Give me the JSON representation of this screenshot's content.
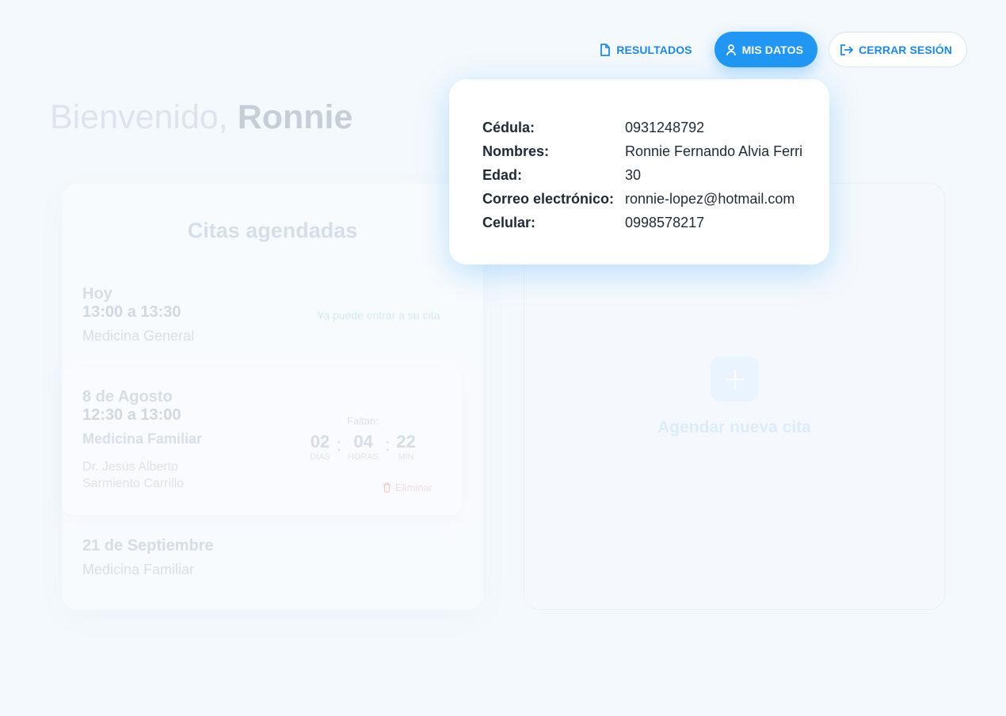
{
  "nav": {
    "results_label": "RESULTADOS",
    "mydata_label": "MIS DATOS",
    "logout_label": "CERRAR SESIÓN"
  },
  "welcome": {
    "greeting": "Bienvenido,",
    "name": "Ronnie"
  },
  "appointments": {
    "title": "Citas agendadas",
    "items": [
      {
        "day": "Hoy",
        "time": "13:00 a 13:30",
        "specialty": "Medicina General",
        "status": "Ya puede entrar a su cita"
      },
      {
        "day": "8 de Agosto",
        "time": "12:30 a 13:00",
        "specialty": "Medicina Familiar",
        "doctor_line1": "Dr. Jesús Alberto",
        "doctor_line2": "Sarmiento Carrillo",
        "countdown_label": "Faltan:",
        "days": "02",
        "days_label": "DÍAS",
        "hours": "04",
        "hours_label": "HORAS",
        "minutes": "22",
        "minutes_label": "MIN",
        "delete_label": "Eliminar"
      },
      {
        "day": "21 de Septiembre",
        "specialty": "Medicina Familiar"
      }
    ]
  },
  "new_appointment": {
    "label": "Agendar nueva cita"
  },
  "profile": {
    "cedula_label": "Cédula:",
    "cedula": "0931248792",
    "nombres_label": "Nombres:",
    "nombres": "Ronnie Fernando Alvia Ferri",
    "edad_label": "Edad:",
    "edad": "30",
    "correo_label": "Correo electrónico:",
    "correo": "ronnie-lopez@hotmail.com",
    "celular_label": "Celular:",
    "celular": "0998578217"
  },
  "colors": {
    "accent": "#2196f3",
    "danger": "#e57373"
  }
}
